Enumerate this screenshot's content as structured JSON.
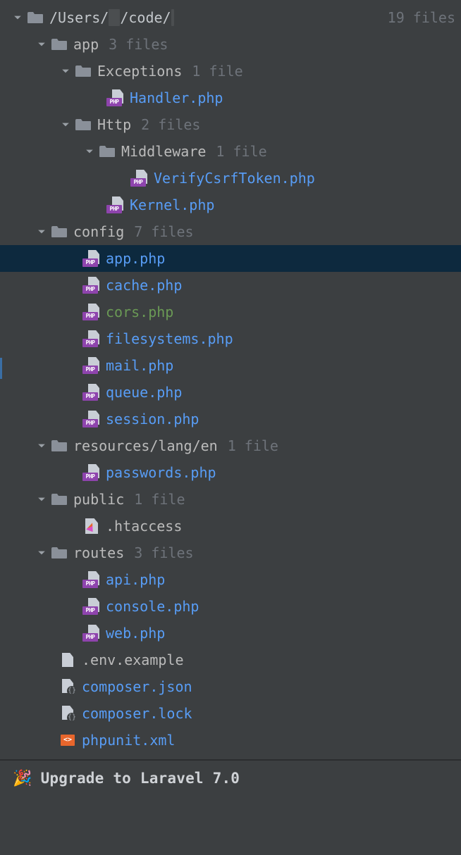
{
  "root": {
    "path_prefix": "/Users/",
    "path_mid_hidden": "          ",
    "path_suffix": "/code/",
    "path_tail_hidden": "             ",
    "meta": "19 files"
  },
  "rows": [
    {
      "type": "folder",
      "arrow": true,
      "indent": 1,
      "name": "app",
      "meta": "3 files",
      "color": "gray"
    },
    {
      "type": "folder",
      "arrow": true,
      "indent": 2,
      "name": "Exceptions",
      "meta": "1 file",
      "color": "gray"
    },
    {
      "type": "php",
      "indent": 4,
      "name": "Handler.php",
      "color": "link"
    },
    {
      "type": "folder",
      "arrow": true,
      "indent": 2,
      "name": "Http",
      "meta": "2 files",
      "color": "gray"
    },
    {
      "type": "folder",
      "arrow": true,
      "indent": 3,
      "name": "Middleware",
      "meta": "1 file",
      "color": "gray"
    },
    {
      "type": "php",
      "indent": 5,
      "name": "VerifyCsrfToken.php",
      "color": "link"
    },
    {
      "type": "php",
      "indent": 4,
      "name": "Kernel.php",
      "color": "link"
    },
    {
      "type": "folder",
      "arrow": true,
      "indent": 1,
      "name": "config",
      "meta": "7 files",
      "color": "gray"
    },
    {
      "type": "php",
      "indent": 3,
      "name": "app.php",
      "color": "link",
      "selected": true
    },
    {
      "type": "php",
      "indent": 3,
      "name": "cache.php",
      "color": "link"
    },
    {
      "type": "php",
      "indent": 3,
      "name": "cors.php",
      "color": "green"
    },
    {
      "type": "php",
      "indent": 3,
      "name": "filesystems.php",
      "color": "link"
    },
    {
      "type": "php",
      "indent": 3,
      "name": "mail.php",
      "color": "link"
    },
    {
      "type": "php",
      "indent": 3,
      "name": "queue.php",
      "color": "link"
    },
    {
      "type": "php",
      "indent": 3,
      "name": "session.php",
      "color": "link"
    },
    {
      "type": "folder",
      "arrow": true,
      "indent": 1,
      "name": "resources/lang/en",
      "meta": "1 file",
      "color": "gray"
    },
    {
      "type": "php",
      "indent": 3,
      "name": "passwords.php",
      "color": "link"
    },
    {
      "type": "folder",
      "arrow": true,
      "indent": 1,
      "name": "public",
      "meta": "1 file",
      "color": "gray"
    },
    {
      "type": "htaccess",
      "indent": 3,
      "name": ".htaccess",
      "color": "gray"
    },
    {
      "type": "folder",
      "arrow": true,
      "indent": 1,
      "name": "routes",
      "meta": "3 files",
      "color": "gray"
    },
    {
      "type": "php",
      "indent": 3,
      "name": "api.php",
      "color": "link"
    },
    {
      "type": "php",
      "indent": 3,
      "name": "console.php",
      "color": "link"
    },
    {
      "type": "php",
      "indent": 3,
      "name": "web.php",
      "color": "link"
    },
    {
      "type": "file",
      "indent": 2,
      "name": ".env.example",
      "color": "gray"
    },
    {
      "type": "json",
      "indent": 2,
      "name": "composer.json",
      "color": "link"
    },
    {
      "type": "json",
      "indent": 2,
      "name": "composer.lock",
      "color": "link"
    },
    {
      "type": "xml",
      "indent": 2,
      "name": "phpunit.xml",
      "color": "link"
    }
  ],
  "footer": {
    "emoji": "🎉",
    "text": "Upgrade to Laravel 7.0"
  },
  "php_badge": "PHP",
  "xml_badge": "<>"
}
